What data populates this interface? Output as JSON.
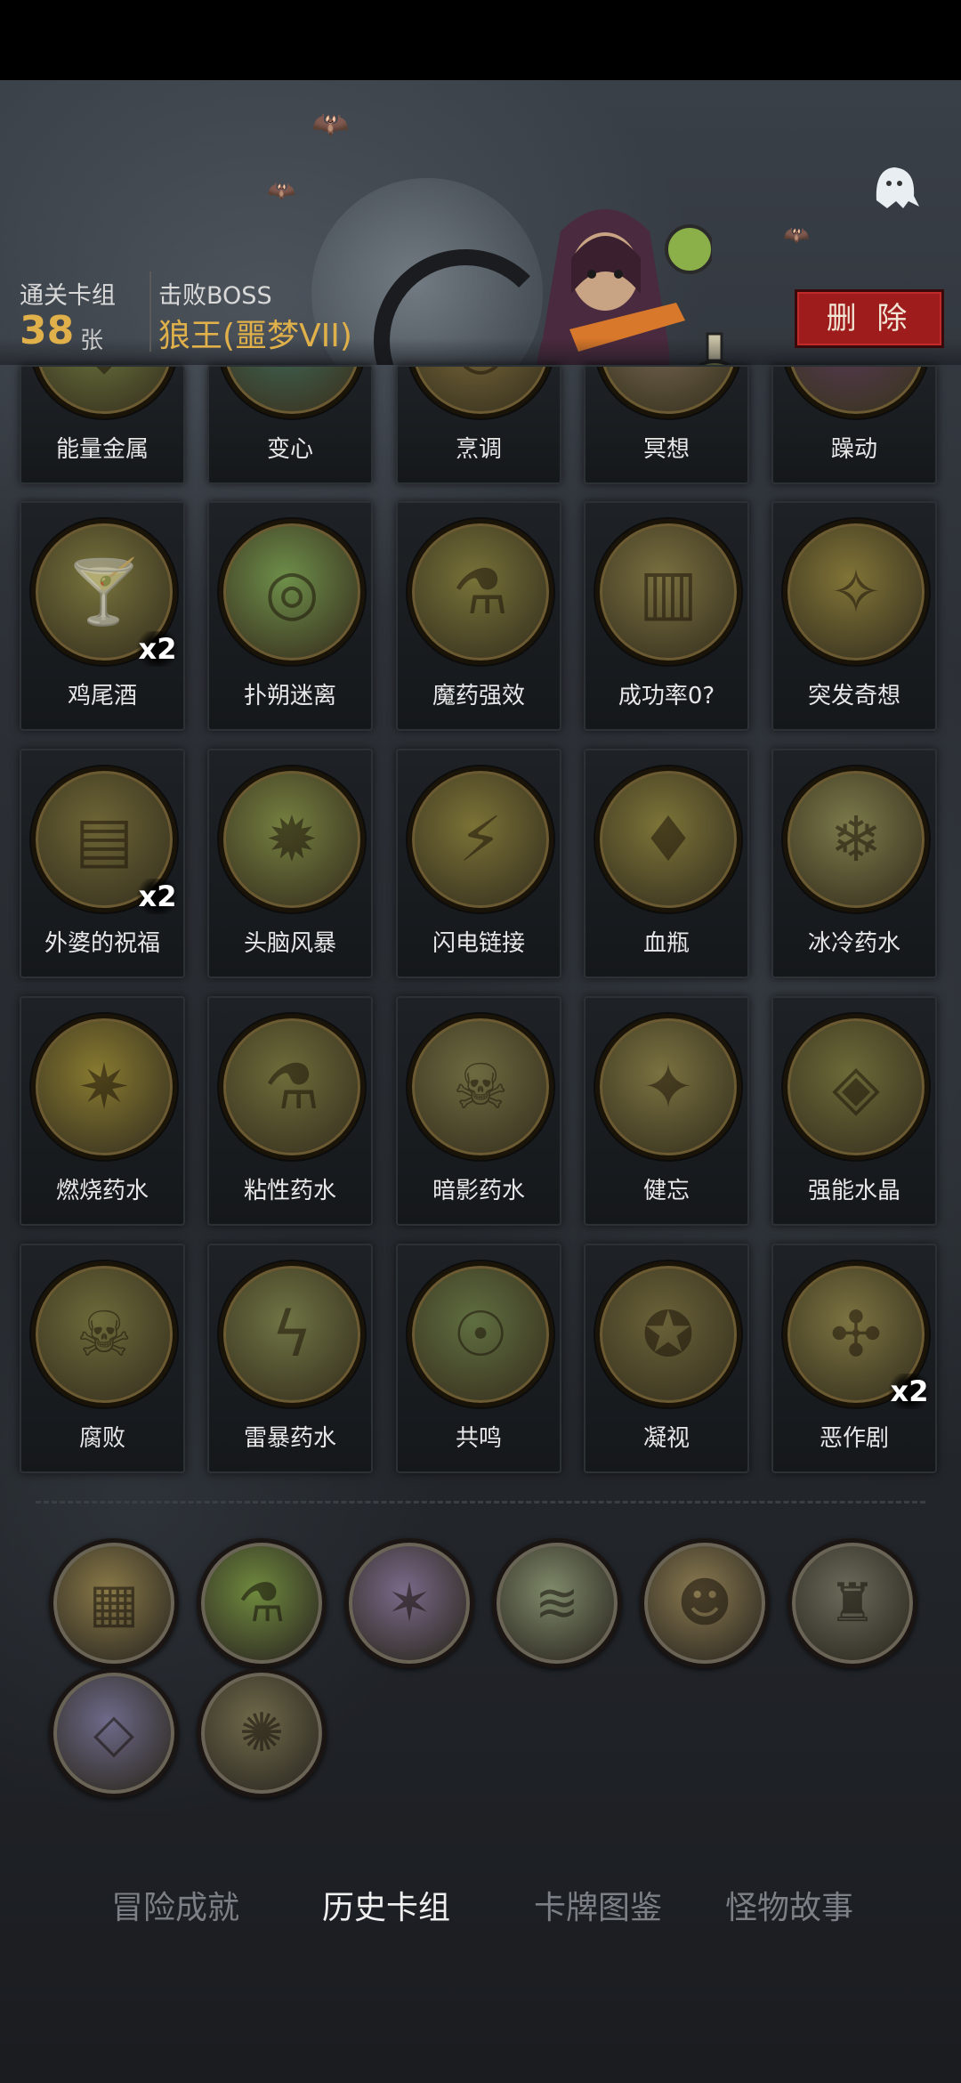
{
  "header": {
    "cleared_deck_label": "通关卡组",
    "card_count": "38",
    "card_unit": "张",
    "defeated_boss_label": "击败BOSS",
    "boss_name": "狼王(噩梦VII)",
    "delete_label": "删 除"
  },
  "partial_row": [
    {
      "name": "能量金属",
      "color": "#6e7a40",
      "icon": "shield-icon"
    },
    {
      "name": "变心",
      "color": "#3f6a5a",
      "icon": "heart-icon"
    },
    {
      "name": "烹调",
      "color": "#7d6a3a",
      "icon": "pot-icon"
    },
    {
      "name": "冥想",
      "color": "#7a6a55",
      "icon": "meditate-icon"
    },
    {
      "name": "躁动",
      "color": "#5a3a5a",
      "icon": "chaos-icon"
    }
  ],
  "cards": [
    {
      "name": "鸡尾酒",
      "count": "x2",
      "color": "#78733c",
      "icon": "cocktail-icon"
    },
    {
      "name": "扑朔迷离",
      "count": "",
      "color": "#6e8f4a",
      "icon": "maze-icon"
    },
    {
      "name": "魔药强效",
      "count": "",
      "color": "#777238",
      "icon": "potion-icon"
    },
    {
      "name": "成功率0?",
      "count": "",
      "color": "#7a7040",
      "icon": "cage-icon"
    },
    {
      "name": "突发奇想",
      "count": "",
      "color": "#817437",
      "icon": "idea-icon"
    },
    {
      "name": "外婆的祝福",
      "count": "x2",
      "color": "#6d6535",
      "icon": "book-icon"
    },
    {
      "name": "头脑风暴",
      "count": "",
      "color": "#758040",
      "icon": "brain-icon"
    },
    {
      "name": "闪电链接",
      "count": "",
      "color": "#7b7236",
      "icon": "lightning-icon"
    },
    {
      "name": "血瓶",
      "count": "",
      "color": "#7d7438",
      "icon": "blood-vial-icon"
    },
    {
      "name": "冰冷药水",
      "count": "",
      "color": "#7b7a4a",
      "icon": "ice-potion-icon"
    },
    {
      "name": "燃烧药水",
      "count": "",
      "color": "#887a30",
      "icon": "fire-potion-icon"
    },
    {
      "name": "粘性药水",
      "count": "",
      "color": "#6e6c3a",
      "icon": "sticky-potion-icon"
    },
    {
      "name": "暗影药水",
      "count": "",
      "color": "#6e6a40",
      "icon": "shadow-potion-icon"
    },
    {
      "name": "健忘",
      "count": "",
      "color": "#7a7240",
      "icon": "dizzy-icon"
    },
    {
      "name": "强能水晶",
      "count": "",
      "color": "#6c6a38",
      "icon": "crystal-icon"
    },
    {
      "name": "腐败",
      "count": "",
      "color": "#6d6a3a",
      "icon": "skull-icon"
    },
    {
      "name": "雷暴药水",
      "count": "",
      "color": "#6f7444",
      "icon": "storm-potion-icon"
    },
    {
      "name": "共鸣",
      "count": "",
      "color": "#5f6e40",
      "icon": "resonance-icon"
    },
    {
      "name": "凝视",
      "count": "",
      "color": "#6a6238",
      "icon": "owl-icon"
    },
    {
      "name": "恶作剧",
      "count": "x2",
      "color": "#7b7340",
      "icon": "voodoo-icon"
    }
  ],
  "relics": [
    {
      "color": "#8a7a48",
      "icon": "cards-icon"
    },
    {
      "color": "#6f8a3e",
      "icon": "green-potion-icon"
    },
    {
      "color": "#7a6a8a",
      "icon": "unicorn-icon"
    },
    {
      "color": "#7f8a6a",
      "icon": "smoke-icon"
    },
    {
      "color": "#8a7a50",
      "icon": "pirate-icon"
    },
    {
      "color": "#6a6a5a",
      "icon": "statue-icon"
    },
    {
      "color": "#6e6a8a",
      "icon": "crystal-vial-icon"
    },
    {
      "color": "#6f6a4a",
      "icon": "pumpkin-icon"
    }
  ],
  "tabs": [
    {
      "label": "冒险成就",
      "active": false
    },
    {
      "label": "历史卡组",
      "active": true
    },
    {
      "label": "卡牌图鉴",
      "active": false
    },
    {
      "label": "怪物故事",
      "active": false
    }
  ]
}
